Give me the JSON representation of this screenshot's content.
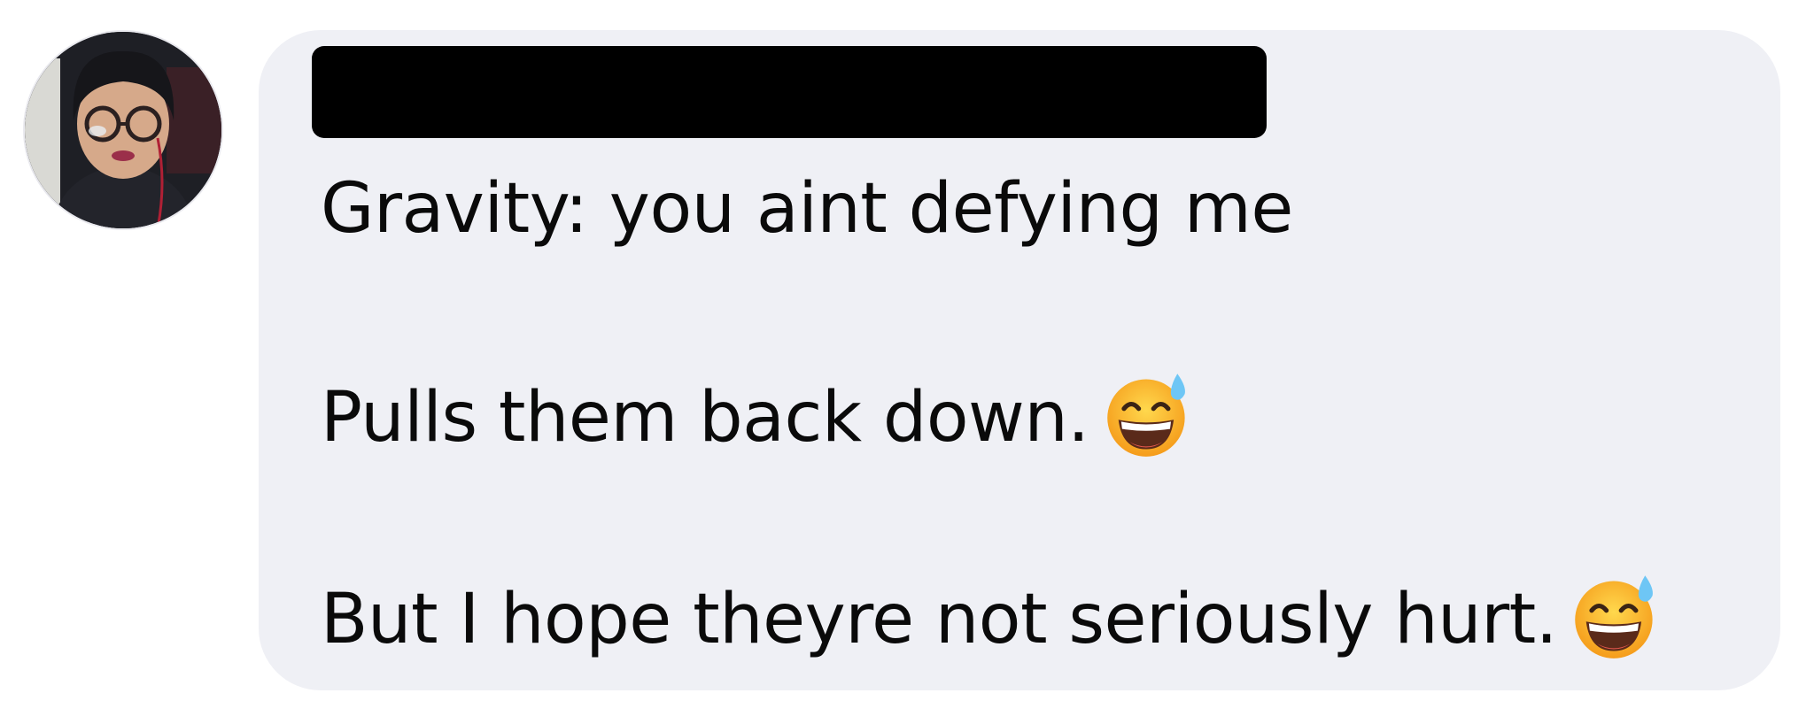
{
  "message": {
    "lines": [
      "Gravity: you aint defying me",
      "Pulls them back down.",
      "But I hope theyre not seriously hurt."
    ],
    "line_emojis": [
      "",
      "grinning-face-with-sweat-icon",
      "grinning-face-with-sweat-icon"
    ]
  },
  "colors": {
    "bubble_background": "#eff0f5",
    "text": "#0a0a0a",
    "redaction": "#000000"
  }
}
